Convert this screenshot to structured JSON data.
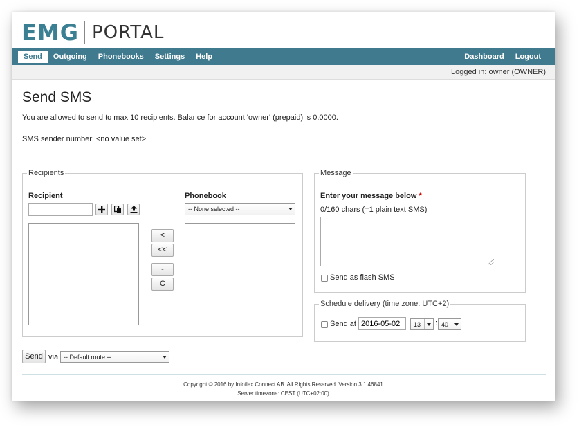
{
  "brand": {
    "logo_primary": "EMG",
    "logo_secondary": "PORTAL",
    "accent_color": "#3f7a8e"
  },
  "nav": {
    "left": [
      {
        "label": "Send",
        "active": true
      },
      {
        "label": "Outgoing"
      },
      {
        "label": "Phonebooks"
      },
      {
        "label": "Settings"
      },
      {
        "label": "Help"
      }
    ],
    "right": [
      {
        "label": "Dashboard"
      },
      {
        "label": "Logout"
      }
    ]
  },
  "userbar": {
    "text": "Logged in: owner (OWNER)"
  },
  "page": {
    "title": "Send SMS",
    "info": "You are allowed to send to max 10 recipients. Balance for account 'owner' (prepaid) is 0.0000.",
    "sender": "SMS sender number: <no value set>"
  },
  "recipients": {
    "legend": "Recipients",
    "recipient_label": "Recipient",
    "recipient_value": "",
    "phonebook_label": "Phonebook",
    "phonebook_selected": "-- None selected --",
    "buttons": {
      "move_one": "<",
      "move_all": "<<",
      "remove": "-",
      "clear": "C"
    },
    "icons": {
      "add": "plus-icon",
      "paste": "paste-icon",
      "upload": "upload-icon"
    }
  },
  "message": {
    "legend": "Message",
    "label": "Enter your message below",
    "required_mark": "*",
    "counter": "0/160 chars (=1 plain text SMS)",
    "body": "",
    "flash_label": "Send as flash SMS",
    "flash_checked": false
  },
  "schedule": {
    "legend": "Schedule delivery (time zone: UTC+2)",
    "send_at_label": "Send at",
    "send_at_checked": false,
    "date": "2016-05-02",
    "hour": "13",
    "minute": "40",
    "separator": ":"
  },
  "send": {
    "button": "Send",
    "via": "via",
    "route": "-- Default route --"
  },
  "footer": {
    "copyright": "Copyright © 2016 by Infoflex Connect AB. All Rights Reserved. Version 3.1.46841",
    "timezone": "Server timezone: CEST (UTC+02:00)"
  }
}
